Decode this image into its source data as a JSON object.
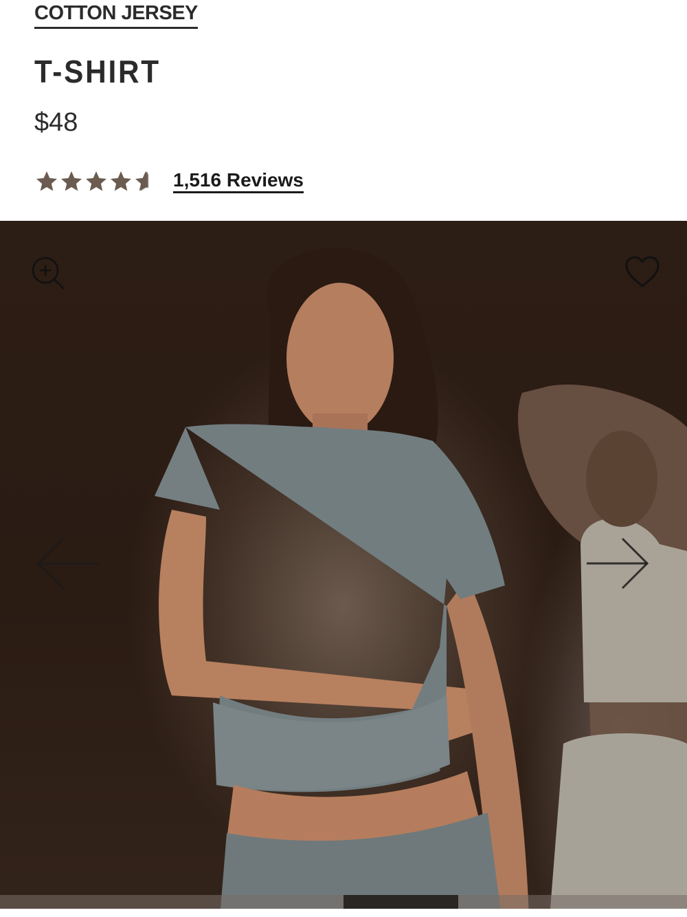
{
  "product": {
    "collection": "COTTON JERSEY",
    "title": "T-SHIRT",
    "price": "$48",
    "rating": {
      "stars_filled": 4.5,
      "stars_total": 5,
      "star_color": "#6b5b50",
      "reviews_label": "1,516 Reviews"
    }
  },
  "gallery": {
    "icons": {
      "zoom": "zoom-in-icon",
      "wishlist": "heart-icon",
      "prev": "arrow-left-icon",
      "next": "arrow-right-icon"
    },
    "image_count": 6,
    "active_index": 3
  }
}
